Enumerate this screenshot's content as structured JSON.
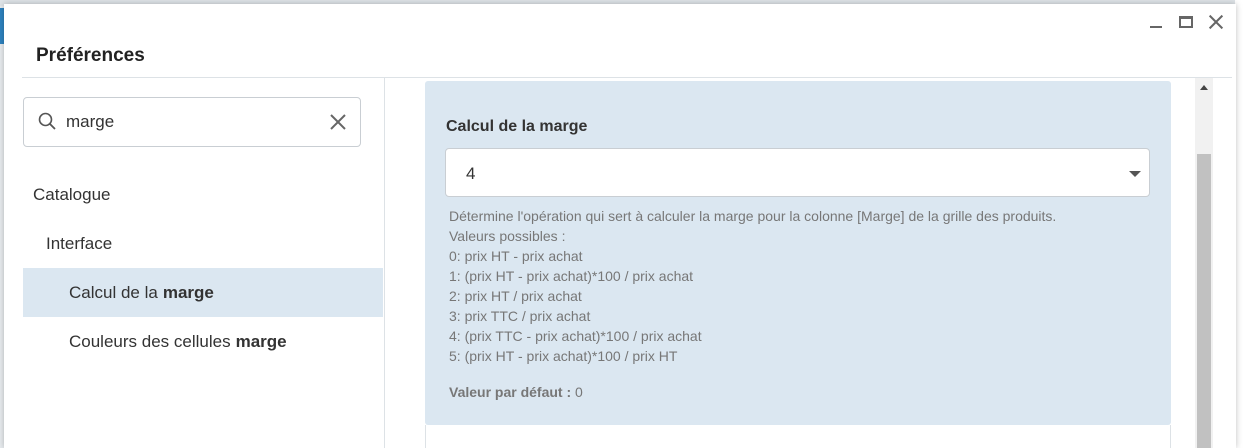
{
  "dialog": {
    "title": "Préférences"
  },
  "search": {
    "value": "marge"
  },
  "tree": {
    "items": [
      {
        "label": "Catalogue",
        "bold": ""
      },
      {
        "label": "Interface",
        "bold": ""
      },
      {
        "label": "Calcul de la",
        "bold": "marge",
        "selected": true
      },
      {
        "label": "Couleurs des cellules",
        "bold": "marge"
      }
    ]
  },
  "setting": {
    "label": "Calcul de la marge",
    "selected_value": "4",
    "description_lines": [
      "Détermine l'opération qui sert à calculer la marge pour la colonne [Marge] de la grille des produits.",
      "Valeurs possibles :",
      "0: prix HT - prix achat",
      "1: (prix HT - prix achat)*100 / prix achat",
      "2: prix HT / prix achat",
      "3: prix TTC / prix achat",
      "4: (prix TTC - prix achat)*100 / prix achat",
      "5: (prix HT - prix achat)*100 / prix HT"
    ],
    "default_label": "Valeur par défaut :",
    "default_value": "0"
  },
  "colors": {
    "selected_bg": "#dbe7f1",
    "card_bg": "#dbe7f1",
    "accent": "#2e83c0"
  },
  "icons": [
    "search-icon",
    "clear-icon",
    "minimize-icon",
    "maximize-icon",
    "close-icon",
    "chevron-down-icon",
    "scroll-up-icon"
  ]
}
